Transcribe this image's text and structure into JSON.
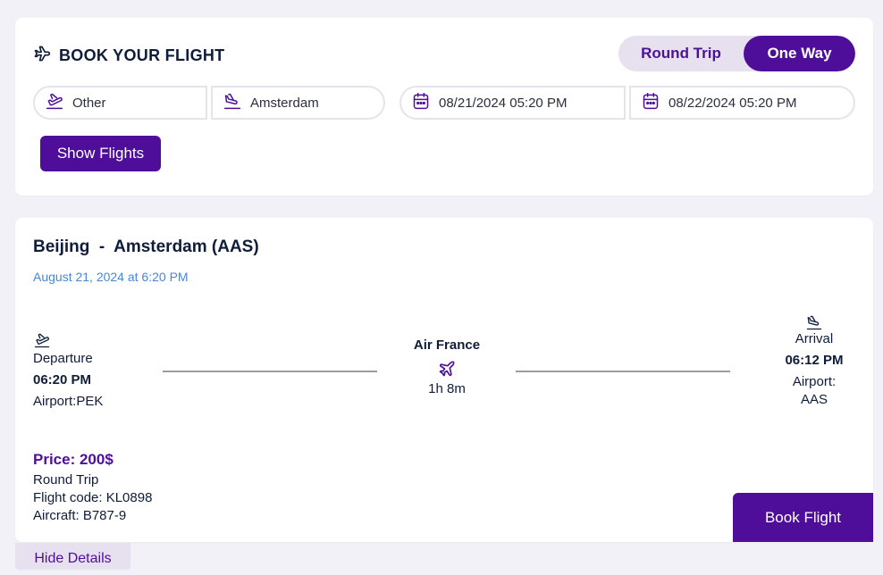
{
  "header": {
    "title": "BOOK YOUR FLIGHT",
    "trip_types": [
      "Round Trip",
      "One Way"
    ],
    "selected_trip_type": "One Way"
  },
  "search": {
    "from": "Other",
    "to": "Amsterdam",
    "departure": "08/21/2024 05:20 PM",
    "return": "08/22/2024 05:20 PM",
    "show_button": "Show Flights"
  },
  "result": {
    "origin": "Beijing",
    "separator": "-",
    "destination": "Amsterdam (AAS)",
    "date_text": "August 21, 2024 at 6:20 PM",
    "departure_label": "Departure",
    "departure_time": "06:20 PM",
    "departure_airport": "Airport:PEK",
    "airline": "Air France",
    "duration": "1h 8m",
    "arrival_label": "Arrival",
    "arrival_time": "06:12 PM",
    "arrival_airport": "Airport: AAS",
    "price": "Price: 200$",
    "trip_type": "Round Trip",
    "flight_code": "Flight code: KL0898",
    "aircraft": "Aircraft: B787-9",
    "book_button": "Book Flight",
    "hide_button": "Hide Details"
  },
  "colors": {
    "accent": "#4e0e99",
    "toggle_bg": "#e7e1ef",
    "date_link": "#4a86d8",
    "page_bg": "#f3f1f8"
  },
  "icons": [
    "plane-icon",
    "takeoff-icon",
    "landing-icon",
    "calendar-icon"
  ]
}
